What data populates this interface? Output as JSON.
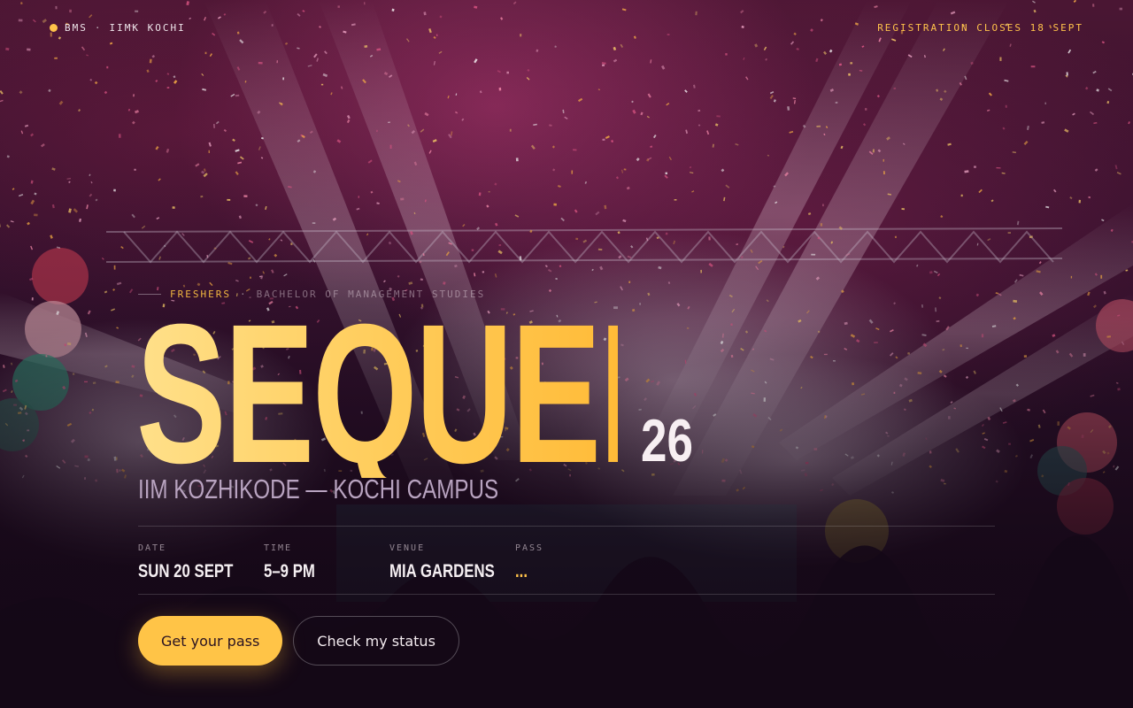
{
  "colors": {
    "accent": "#ffc24a",
    "background": "#1a0c1c",
    "muted": "#b8a3c0"
  },
  "header": {
    "brand_dot_icon": "status-dot-icon",
    "brand_primary": "BMS",
    "brand_separator": "·",
    "brand_secondary": "IIMK KOCHI",
    "registration_note": "REGISTRATION CLOSES 18 SEPT"
  },
  "hero": {
    "eyebrow_tag": "FRESHERS",
    "eyebrow_separator": "·",
    "eyebrow_subtitle": "BACHELOR OF MANAGEMENT STUDIES",
    "title": "SEQUEL",
    "year": "26",
    "campus": "IIM KOZHIKODE — KOCHI CAMPUS"
  },
  "details": [
    {
      "label": "DATE",
      "value": "SUN 20 SEPT"
    },
    {
      "label": "TIME",
      "value": "5–9 PM"
    },
    {
      "label": "VENUE",
      "value": "MIA GARDENS"
    },
    {
      "label": "PASS",
      "value": "..."
    }
  ],
  "actions": {
    "primary_label": "Get your pass",
    "secondary_label": "Check my status"
  }
}
